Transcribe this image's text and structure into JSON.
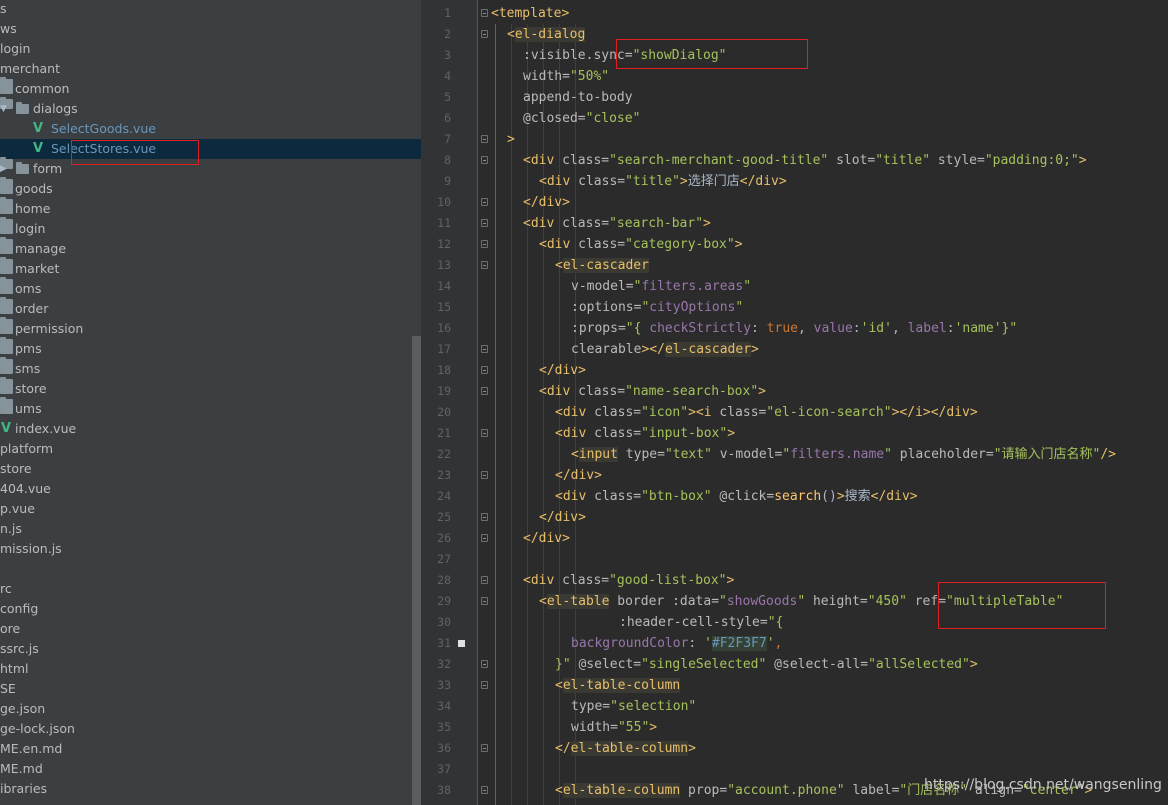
{
  "project_tree": {
    "items": [
      {
        "label": "s",
        "kind": "text",
        "indent": 0
      },
      {
        "label": "ws",
        "kind": "text",
        "indent": 0
      },
      {
        "label": "login",
        "kind": "text",
        "indent": 0
      },
      {
        "label": "merchant",
        "kind": "text",
        "indent": 0
      },
      {
        "label": "common",
        "kind": "folder",
        "indent": 1
      },
      {
        "label": "dialogs",
        "kind": "folder",
        "indent": 1,
        "expanded": true
      },
      {
        "label": "SelectGoods.vue",
        "kind": "vue",
        "indent": 2
      },
      {
        "label": "SelectStores.vue",
        "kind": "vue",
        "indent": 2,
        "selected": true
      },
      {
        "label": "form",
        "kind": "folder",
        "indent": 1,
        "collapsed": true
      },
      {
        "label": "goods",
        "kind": "folder",
        "indent": 1
      },
      {
        "label": "home",
        "kind": "folder",
        "indent": 1
      },
      {
        "label": "login",
        "kind": "folder",
        "indent": 1
      },
      {
        "label": "manage",
        "kind": "folder",
        "indent": 1
      },
      {
        "label": "market",
        "kind": "folder",
        "indent": 1
      },
      {
        "label": "oms",
        "kind": "folder",
        "indent": 1
      },
      {
        "label": "order",
        "kind": "folder",
        "indent": 1
      },
      {
        "label": "permission",
        "kind": "folder",
        "indent": 1
      },
      {
        "label": "pms",
        "kind": "folder",
        "indent": 1
      },
      {
        "label": "sms",
        "kind": "folder",
        "indent": 1
      },
      {
        "label": "store",
        "kind": "folder",
        "indent": 1
      },
      {
        "label": "ums",
        "kind": "folder",
        "indent": 1
      },
      {
        "label": "index.vue",
        "kind": "plain-vue",
        "indent": 1
      },
      {
        "label": "platform",
        "kind": "text",
        "indent": 0
      },
      {
        "label": "store",
        "kind": "text",
        "indent": 0
      },
      {
        "label": "404.vue",
        "kind": "text",
        "indent": 0
      },
      {
        "label": "p.vue",
        "kind": "text",
        "indent": 0
      },
      {
        "label": "n.js",
        "kind": "text",
        "indent": 0
      },
      {
        "label": "mission.js",
        "kind": "text",
        "indent": 0
      },
      {
        "label": "",
        "kind": "text",
        "indent": 0
      },
      {
        "label": "rc",
        "kind": "text",
        "indent": 0
      },
      {
        "label": "config",
        "kind": "text",
        "indent": 0
      },
      {
        "label": "ore",
        "kind": "text",
        "indent": 0
      },
      {
        "label": "ssrc.js",
        "kind": "text",
        "indent": 0
      },
      {
        "label": "html",
        "kind": "text",
        "indent": 0
      },
      {
        "label": "SE",
        "kind": "text",
        "indent": 0
      },
      {
        "label": "ge.json",
        "kind": "text",
        "indent": 0
      },
      {
        "label": "ge-lock.json",
        "kind": "text",
        "indent": 0
      },
      {
        "label": "ME.en.md",
        "kind": "text",
        "indent": 0
      },
      {
        "label": "ME.md",
        "kind": "text",
        "indent": 0
      },
      {
        "label": "ibraries",
        "kind": "text",
        "indent": 0
      }
    ]
  },
  "editor": {
    "lines": [
      {
        "n": "1",
        "fold": true,
        "indent": 0,
        "segs": [
          [
            "tag",
            "<template>"
          ]
        ]
      },
      {
        "n": "2",
        "fold": true,
        "indent": 1,
        "segs": [
          [
            "tag",
            "<"
          ],
          [
            "hltag",
            "el-dialog"
          ]
        ]
      },
      {
        "n": "3",
        "indent": 2,
        "segs": [
          [
            "attr",
            ":visible.sync="
          ],
          [
            "val",
            "\"showDialog\""
          ]
        ]
      },
      {
        "n": "4",
        "indent": 2,
        "segs": [
          [
            "attr",
            "width="
          ],
          [
            "val",
            "\"50%\""
          ]
        ]
      },
      {
        "n": "5",
        "indent": 2,
        "segs": [
          [
            "attr",
            "append-to-body"
          ]
        ]
      },
      {
        "n": "6",
        "indent": 2,
        "segs": [
          [
            "attr",
            "@closed="
          ],
          [
            "val",
            "\"close\""
          ]
        ]
      },
      {
        "n": "7",
        "fold": true,
        "indent": 1,
        "segs": [
          [
            "tag",
            ">"
          ]
        ]
      },
      {
        "n": "8",
        "fold": true,
        "indent": 2,
        "segs": [
          [
            "tag",
            "<div "
          ],
          [
            "attr",
            "class="
          ],
          [
            "val",
            "\"search-merchant-good-title\" "
          ],
          [
            "attr",
            "slot="
          ],
          [
            "val",
            "\"title\" "
          ],
          [
            "attr",
            "style="
          ],
          [
            "val",
            "\"padding:0;\""
          ],
          [
            "tag",
            ">"
          ]
        ]
      },
      {
        "n": "9",
        "indent": 3,
        "segs": [
          [
            "tag",
            "<div "
          ],
          [
            "attr",
            "class="
          ],
          [
            "val",
            "\"title\""
          ],
          [
            "tag",
            ">"
          ],
          [
            "text",
            "选择门店"
          ],
          [
            "tag",
            "</div>"
          ]
        ]
      },
      {
        "n": "10",
        "fold": true,
        "indent": 2,
        "segs": [
          [
            "tag",
            "</div>"
          ]
        ]
      },
      {
        "n": "11",
        "fold": true,
        "indent": 2,
        "segs": [
          [
            "tag",
            "<div "
          ],
          [
            "attr",
            "class="
          ],
          [
            "val",
            "\"search-bar\""
          ],
          [
            "tag",
            ">"
          ]
        ]
      },
      {
        "n": "12",
        "fold": true,
        "indent": 3,
        "segs": [
          [
            "tag",
            "<div "
          ],
          [
            "attr",
            "class="
          ],
          [
            "val",
            "\"category-box\""
          ],
          [
            "tag",
            ">"
          ]
        ]
      },
      {
        "n": "13",
        "fold": true,
        "indent": 4,
        "segs": [
          [
            "tag",
            "<"
          ],
          [
            "hltag",
            "el-cascader"
          ]
        ]
      },
      {
        "n": "14",
        "indent": 5,
        "segs": [
          [
            "attr",
            "v-model="
          ],
          [
            "val",
            "\""
          ],
          [
            "ident",
            "filters.areas"
          ],
          [
            "val",
            "\""
          ]
        ]
      },
      {
        "n": "15",
        "indent": 5,
        "segs": [
          [
            "attr",
            ":options="
          ],
          [
            "val",
            "\""
          ],
          [
            "ident",
            "cityOptions"
          ],
          [
            "val",
            "\""
          ]
        ]
      },
      {
        "n": "16",
        "indent": 5,
        "segs": [
          [
            "attr",
            ":props="
          ],
          [
            "val",
            "\"{ "
          ],
          [
            "ident",
            "checkStrictly"
          ],
          [
            "text",
            ": "
          ],
          [
            "kw",
            "true"
          ],
          [
            "text",
            ", "
          ],
          [
            "ident",
            "value"
          ],
          [
            "text",
            ":"
          ],
          [
            "val",
            "'id'"
          ],
          [
            "text",
            ", "
          ],
          [
            "ident",
            "label"
          ],
          [
            "text",
            ":"
          ],
          [
            "val",
            "'name'"
          ],
          [
            "val",
            "}\""
          ]
        ]
      },
      {
        "n": "17",
        "fold": true,
        "indent": 5,
        "segs": [
          [
            "attr",
            "clearable"
          ],
          [
            "tag",
            ">"
          ],
          [
            "tag",
            "</"
          ],
          [
            "hltag",
            "el-cascader"
          ],
          [
            "tag",
            ">"
          ]
        ]
      },
      {
        "n": "18",
        "fold": true,
        "indent": 3,
        "segs": [
          [
            "tag",
            "</div>"
          ]
        ]
      },
      {
        "n": "19",
        "fold": true,
        "indent": 3,
        "segs": [
          [
            "tag",
            "<div "
          ],
          [
            "attr",
            "class="
          ],
          [
            "val",
            "\"name-search-box\""
          ],
          [
            "tag",
            ">"
          ]
        ]
      },
      {
        "n": "20",
        "indent": 4,
        "segs": [
          [
            "tag",
            "<div "
          ],
          [
            "attr",
            "class="
          ],
          [
            "val",
            "\"icon\""
          ],
          [
            "tag",
            ">"
          ],
          [
            "tag",
            "<i "
          ],
          [
            "attr",
            "class="
          ],
          [
            "val",
            "\"el-icon-search\""
          ],
          [
            "tag",
            ">"
          ],
          [
            "tag",
            "</i>"
          ],
          [
            "tag",
            "</div>"
          ]
        ]
      },
      {
        "n": "21",
        "fold": true,
        "indent": 4,
        "segs": [
          [
            "tag",
            "<div "
          ],
          [
            "attr",
            "class="
          ],
          [
            "val",
            "\"input-box\""
          ],
          [
            "tag",
            ">"
          ]
        ]
      },
      {
        "n": "22",
        "indent": 5,
        "segs": [
          [
            "tag",
            "<"
          ],
          [
            "hltag",
            "input"
          ],
          [
            "attr",
            " type="
          ],
          [
            "val",
            "\"text\" "
          ],
          [
            "attr",
            "v-model="
          ],
          [
            "val",
            "\""
          ],
          [
            "ident",
            "filters.name"
          ],
          [
            "val",
            "\" "
          ],
          [
            "attr",
            "placeholder="
          ],
          [
            "val",
            "\"请输入门店名称\""
          ],
          [
            "tag",
            "/>"
          ]
        ]
      },
      {
        "n": "23",
        "fold": true,
        "indent": 4,
        "segs": [
          [
            "tag",
            "</div>"
          ]
        ]
      },
      {
        "n": "24",
        "indent": 4,
        "segs": [
          [
            "tag",
            "<div "
          ],
          [
            "attr",
            "class="
          ],
          [
            "val",
            "\"btn-box\" "
          ],
          [
            "attr",
            "@click="
          ],
          [
            "fn",
            "search"
          ],
          [
            "text",
            "()"
          ],
          [
            "tag",
            ">"
          ],
          [
            "text",
            "搜索"
          ],
          [
            "tag",
            "</div>"
          ]
        ]
      },
      {
        "n": "25",
        "fold": true,
        "indent": 3,
        "segs": [
          [
            "tag",
            "</div>"
          ]
        ]
      },
      {
        "n": "26",
        "fold": true,
        "indent": 2,
        "segs": [
          [
            "tag",
            "</div>"
          ]
        ]
      },
      {
        "n": "27",
        "indent": 0,
        "segs": []
      },
      {
        "n": "28",
        "fold": true,
        "indent": 2,
        "segs": [
          [
            "tag",
            "<div "
          ],
          [
            "attr",
            "class="
          ],
          [
            "val",
            "\"good-list-box\""
          ],
          [
            "tag",
            ">"
          ]
        ]
      },
      {
        "n": "29",
        "fold": true,
        "indent": 3,
        "segs": [
          [
            "tag",
            "<"
          ],
          [
            "hltag",
            "el-table"
          ],
          [
            "attr",
            " border :data="
          ],
          [
            "val",
            "\""
          ],
          [
            "ident",
            "showGoods"
          ],
          [
            "val",
            "\" "
          ],
          [
            "attr",
            "height="
          ],
          [
            "val",
            "\"450\" "
          ],
          [
            "attr",
            "ref="
          ],
          [
            "val",
            "\"multipleTable\""
          ]
        ]
      },
      {
        "n": "30",
        "indent": 8,
        "segs": [
          [
            "attr",
            ":header-cell-style="
          ],
          [
            "val",
            "\"{"
          ]
        ]
      },
      {
        "n": "31",
        "bp": true,
        "indent": 5,
        "segs": [
          [
            "ident",
            "backgroundColor"
          ],
          [
            "text",
            ": "
          ],
          [
            "val",
            "'"
          ],
          [
            "hex",
            "#F2F3F7"
          ],
          [
            "val",
            "'"
          ],
          [
            "kw",
            ","
          ]
        ]
      },
      {
        "n": "32",
        "fold": true,
        "indent": 4,
        "segs": [
          [
            "val",
            "}\" "
          ],
          [
            "attr",
            "@select="
          ],
          [
            "val",
            "\"singleSelected\" "
          ],
          [
            "attr",
            "@select-all="
          ],
          [
            "val",
            "\"allSelected\""
          ],
          [
            "tag",
            ">"
          ]
        ]
      },
      {
        "n": "33",
        "fold": true,
        "indent": 4,
        "segs": [
          [
            "tag",
            "<"
          ],
          [
            "hltag",
            "el-table-column"
          ]
        ]
      },
      {
        "n": "34",
        "indent": 5,
        "segs": [
          [
            "attr",
            "type="
          ],
          [
            "val",
            "\"selection\""
          ]
        ]
      },
      {
        "n": "35",
        "indent": 5,
        "segs": [
          [
            "attr",
            "width="
          ],
          [
            "val",
            "\"55\""
          ],
          [
            "tag",
            ">"
          ]
        ]
      },
      {
        "n": "36",
        "fold": true,
        "indent": 4,
        "segs": [
          [
            "tag",
            "</"
          ],
          [
            "hltag",
            "el-table-column"
          ],
          [
            "tag",
            ">"
          ]
        ]
      },
      {
        "n": "37",
        "indent": 0,
        "segs": []
      },
      {
        "n": "38",
        "fold": true,
        "indent": 4,
        "segs": [
          [
            "tag",
            "<"
          ],
          [
            "hltag",
            "el-table-column"
          ],
          [
            "attr",
            " prop="
          ],
          [
            "val",
            "\"account.phone\" "
          ],
          [
            "attr",
            "label="
          ],
          [
            "val",
            "\"门店名称\" "
          ],
          [
            "attr",
            "align="
          ],
          [
            "val",
            "\"center\""
          ],
          [
            "tag",
            ">"
          ]
        ]
      }
    ]
  },
  "watermark": "https://blog.csdn.net/wangsenling"
}
